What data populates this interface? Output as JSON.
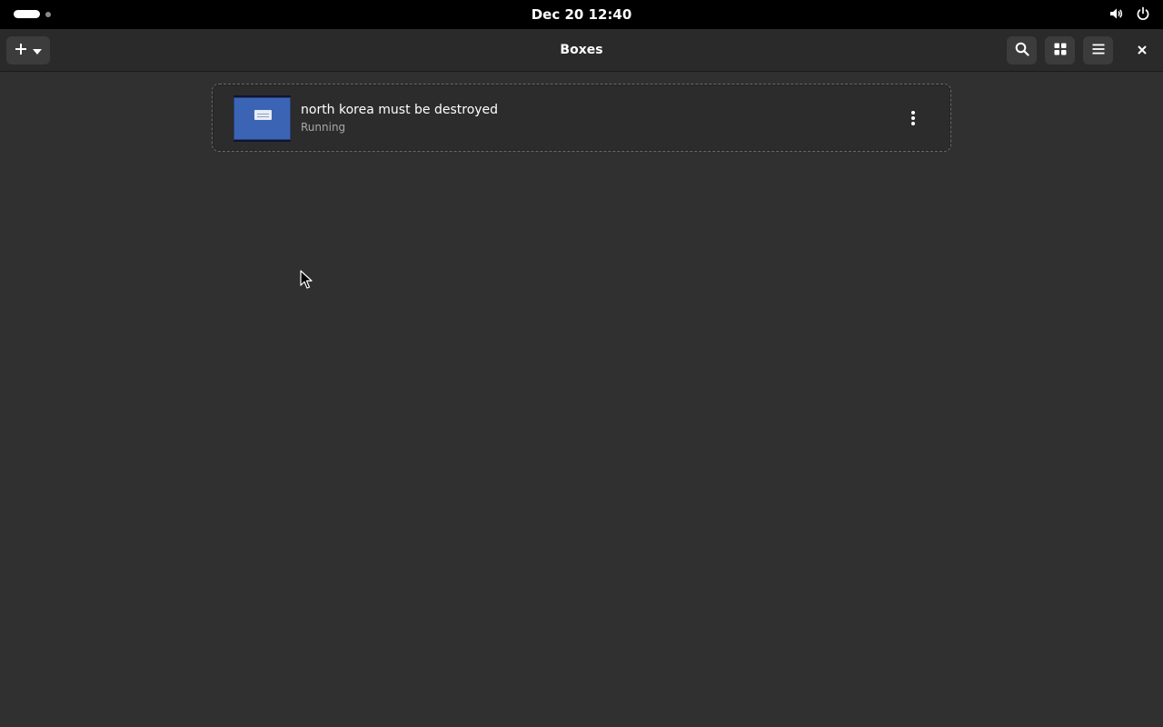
{
  "topbar": {
    "clock": "Dec 20  12:40"
  },
  "header": {
    "title": "Boxes"
  },
  "boxes": [
    {
      "name": "north korea must be destroyed",
      "status": "Running"
    }
  ],
  "colors": {
    "background": "#303030",
    "header": "#2a2a2a",
    "thumbnail": "#3b64b5"
  },
  "icons": {
    "new": "plus-icon",
    "search": "search-icon",
    "view": "grid-view-icon",
    "menu": "hamburger-menu-icon",
    "close": "close-icon",
    "volume": "volume-icon",
    "power": "power-icon"
  }
}
